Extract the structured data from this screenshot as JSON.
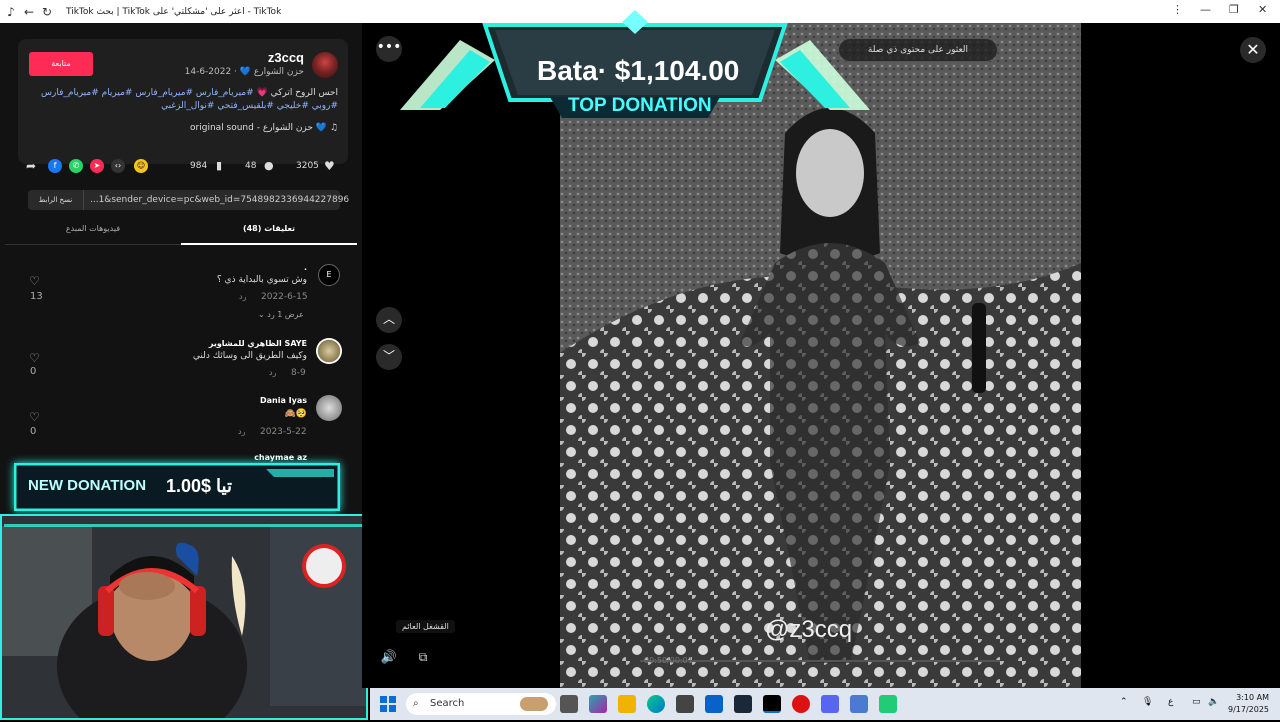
{
  "window": {
    "title": "TikTok بحث | TikTok اعثر على 'مشكلتي' على - TikTok"
  },
  "post": {
    "follow_label": "متابعة",
    "username": "z3ccq",
    "meta": "حزن الشوارع 💙 · 2022-6-14",
    "description": "احس الروح اتركي 💗",
    "tags": "#ميريام_فارس #ميريام_فارس #ميريام #ميريام_فارس #روبي #خليجي #بلقيس_فتحي #نوال_الزغبي",
    "music": "original sound - حزن الشوارع 💙",
    "likes": "3205",
    "comments": "48",
    "saves": "984",
    "copy_link_label": "نسخ الرابط",
    "link": "...1&sender_device=pc&web_id=7548982336944227896"
  },
  "tabs": [
    {
      "label": "(48) تعليقات"
    },
    {
      "label": "فيديوهات المبدع"
    }
  ],
  "comments": [
    {
      "user": ".",
      "text": "وش تسوي بالبداية ذي ؟",
      "date": "2022-6-15",
      "reply": "رد",
      "likes": "13",
      "view_replies": "عرض 1 رد"
    },
    {
      "user": "الظاهري للمشاوير SAYE",
      "text": "وكيف الطريق الى وسائك دلني",
      "date": "8-9",
      "reply": "رد",
      "likes": "0"
    },
    {
      "user": "Dania Iyas",
      "text": "🙈🥺",
      "date": "2023-5-22",
      "reply": "رد",
      "likes": "0"
    },
    {
      "user": "chaymae az",
      "text": "",
      "date": "",
      "reply": "",
      "likes": ""
    }
  ],
  "overlays": {
    "new_donation_label": "NEW DONATION",
    "new_donation_amount": "1.00$ تيا",
    "top_donation_amount": "Bata· $1,104.00",
    "top_donation_label": "TOP DONATION"
  },
  "player": {
    "report_label": "العثور على محتوى ذي صلة",
    "watermark": "@z3ccq",
    "timecode": "00:50/00:01",
    "tooltip": "القشغل العائم"
  },
  "taskbar": {
    "search_placeholder": "Search",
    "lang": "ع",
    "time": "3:10 AM",
    "date": "9/17/2025"
  },
  "colors": {
    "accent": "#fe2c55",
    "overlay_cyan": "#2ef0e0",
    "hashtag": "#8fb4ff"
  }
}
